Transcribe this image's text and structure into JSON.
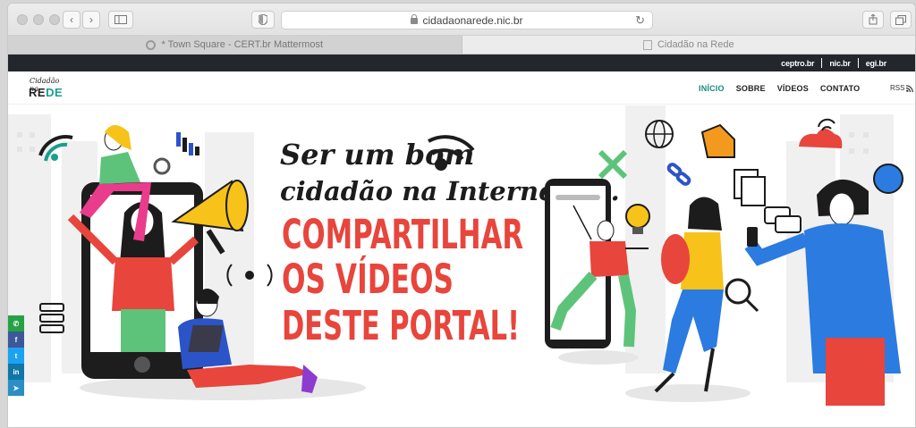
{
  "browser": {
    "url": "cidadaonarede.nic.br",
    "tabs": [
      {
        "label": "* Town Square - CERT.br Mattermost",
        "active": false
      },
      {
        "label": "Cidadão na Rede",
        "active": true
      }
    ]
  },
  "topbar": {
    "links": [
      "ceptro.br",
      "nic.br",
      "egi.br"
    ]
  },
  "logo": {
    "line1": "Cidadão na",
    "line2a": "RE",
    "line2b": "DE"
  },
  "nav": {
    "items": [
      {
        "label": "INÍCIO",
        "active": true
      },
      {
        "label": "SOBRE",
        "active": false
      },
      {
        "label": "VÍDEOS",
        "active": false
      },
      {
        "label": "CONTATO",
        "active": false
      }
    ],
    "rss": "RSS"
  },
  "hero": {
    "line1": "Ser um bom",
    "line2": "cidadão na Internet é...",
    "line3": "COMPARTILHAR",
    "line4": "OS VÍDEOS",
    "line5": "DESTE PORTAL!",
    "colors": {
      "accent": "#e8453c",
      "teal": "#1a9e8e",
      "yellow": "#f7c31a"
    }
  },
  "social": [
    {
      "name": "whatsapp",
      "glyph": "✆",
      "color": "#25a244"
    },
    {
      "name": "facebook",
      "glyph": "f",
      "color": "#3b5998"
    },
    {
      "name": "twitter",
      "glyph": "t",
      "color": "#1da1f2"
    },
    {
      "name": "linkedin",
      "glyph": "in",
      "color": "#0e76a8"
    },
    {
      "name": "telegram",
      "glyph": "➤",
      "color": "#2a8fc7"
    }
  ]
}
